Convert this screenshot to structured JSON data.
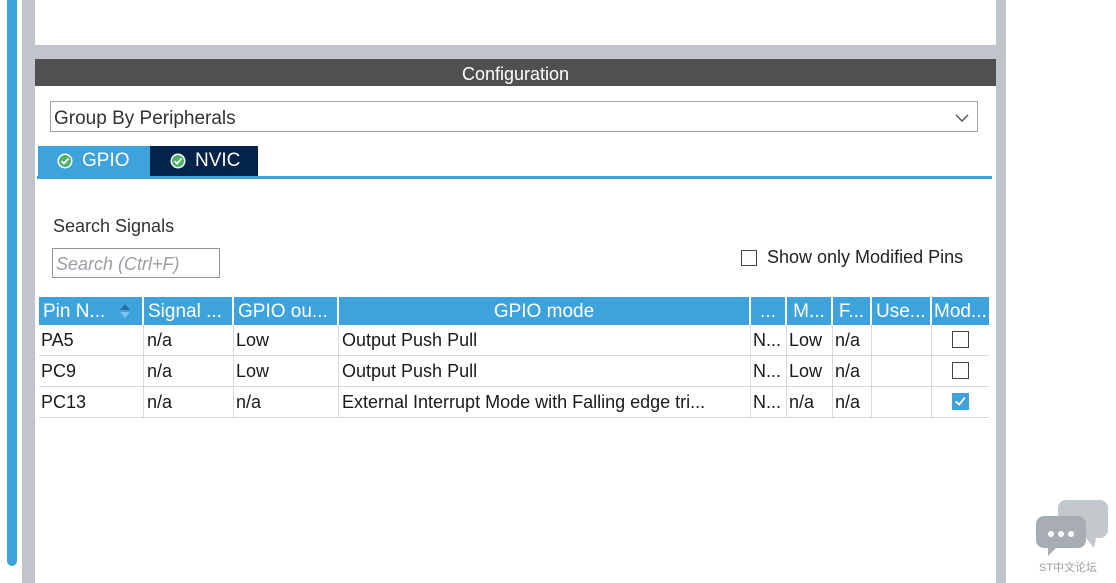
{
  "header": {
    "title": "Configuration"
  },
  "group_select": {
    "value": "Group By Peripherals"
  },
  "tabs": [
    {
      "label": "GPIO",
      "active": true
    },
    {
      "label": "NVIC",
      "active": false
    }
  ],
  "search": {
    "label": "Search Signals",
    "placeholder": "Search (Ctrl+F)"
  },
  "show_modified": {
    "label": "Show only Modified Pins",
    "checked": false
  },
  "table": {
    "headers": [
      "Pin N...",
      "Signal ...",
      "GPIO ou...",
      "GPIO mode",
      "...",
      "M...",
      "F...",
      "Use...",
      "Mod..."
    ],
    "rows": [
      {
        "cells": [
          "PA5",
          "n/a",
          "Low",
          "Output Push Pull",
          "N...",
          "Low",
          "n/a",
          ""
        ],
        "modified": false
      },
      {
        "cells": [
          "PC9",
          "n/a",
          "Low",
          "Output Push Pull",
          "N...",
          "Low",
          "n/a",
          ""
        ],
        "modified": false
      },
      {
        "cells": [
          "PC13",
          "n/a",
          "n/a",
          "External Interrupt Mode with Falling edge tri...",
          "N...",
          "n/a",
          "n/a",
          ""
        ],
        "modified": true
      }
    ]
  },
  "watermark": {
    "text": "ST中文论坛"
  },
  "colors": {
    "accent": "#3ea3dc",
    "header_bg": "#505050",
    "tab_dark": "#03234b",
    "check_green": "#4db26a"
  }
}
